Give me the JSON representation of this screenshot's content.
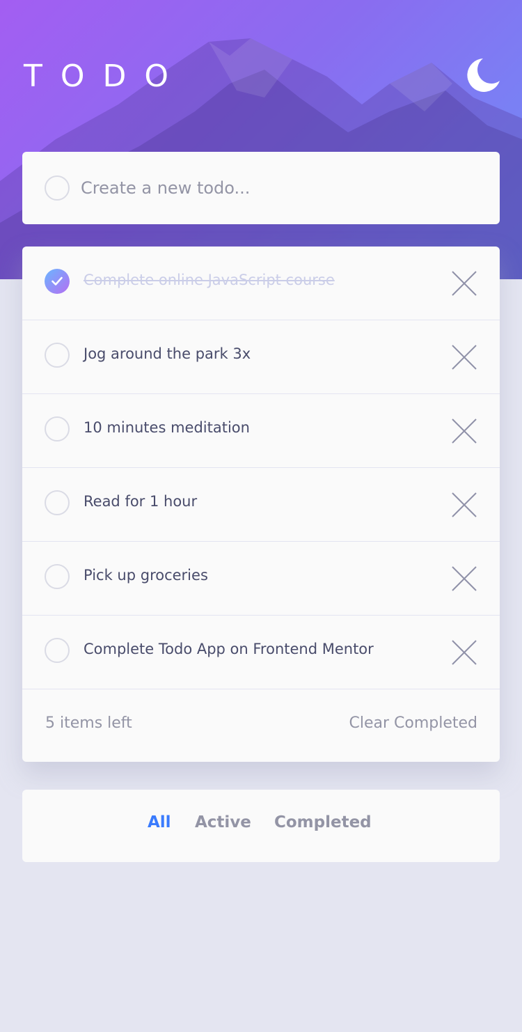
{
  "header": {
    "title": "TODO",
    "theme_icon": "moon-icon"
  },
  "new_todo": {
    "placeholder": "Create a new todo...",
    "value": ""
  },
  "todos": [
    {
      "text": "Complete online JavaScript course",
      "completed": true
    },
    {
      "text": "Jog around the park 3x",
      "completed": false
    },
    {
      "text": "10 minutes meditation",
      "completed": false
    },
    {
      "text": "Read for 1 hour",
      "completed": false
    },
    {
      "text": "Pick up groceries",
      "completed": false
    },
    {
      "text": "Complete Todo App on Frontend Mentor",
      "completed": false
    }
  ],
  "list_footer": {
    "items_left": "5 items left",
    "clear_label": "Clear Completed"
  },
  "filters": {
    "all": "All",
    "active": "Active",
    "completed": "Completed",
    "selected": "All"
  },
  "colors": {
    "accent": "#3a7bfd",
    "check_gradient_start": "#6bb6ff",
    "check_gradient_end": "#b46ef2",
    "text": "#494c6b",
    "muted": "#9394a5"
  }
}
